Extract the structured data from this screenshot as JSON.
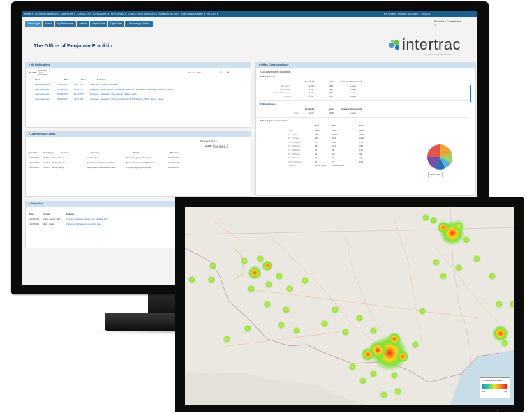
{
  "navbar": {
    "items": [
      "HOME",
      "CORRESPONDENCE",
      "CASEWORK",
      "CONTACTS",
      "SCHEDULING",
      "REPORTING",
      "CONSTITUENT SERVICES",
      "ADMINISTRATION",
      "TIME MANAGEMENT",
      "HISTORY"
    ],
    "right_items": [
      "MY TEAM",
      "CHANGE ACCOUNT",
      "LOGOUT"
    ],
    "search_placeholder": "Find Your Constituent"
  },
  "tabs": [
    "Office Pages",
    "Search",
    "My Preferences",
    "Attacks",
    "Export Data",
    "Digital Mail",
    "Knowledge Center"
  ],
  "page_title": "The Office of Benjamin Franklin",
  "logo": {
    "word": "intertrac",
    "tagline": "BY DATASPHERE DOMESTIC"
  },
  "notifications": {
    "title": "My Notifications",
    "sort_label": "Sort By",
    "sort_value": "Date",
    "pager": "Previous  1  Next",
    "columns": [
      "From",
      "Date",
      "Time",
      "Subject"
    ],
    "rows": [
      [
        "Jasmine Lowes",
        "09/26/2016",
        "03:17 PM",
        "Intertrac Print Batch Complete"
      ],
      [
        "Jasmine Lowes",
        "09/26/2016",
        "03:12 PM",
        "Assigned - Lofton Mange - Immediate action on Placentation Federalism Institute - Camp..."
      ],
      [
        "Jasmine Lowes",
        "09/26/2016",
        "03:10 PM",
        "Assigned - Research - Ping support - Mass Cases"
      ],
      [
        "Jasmine Lowes",
        "09/26/2016",
        "03:07 PM",
        "Assigned - Research - Prison contact with WTHOLESON PRAY - Ebrolt, James"
      ]
    ]
  },
  "casework": {
    "title": "Casework Due Dates",
    "pager": "Previous  1  Next",
    "sort_label": "Sort By",
    "sort_value": "Due Date",
    "columns": [
      "Due Date",
      "Tracking #",
      "Contact",
      "Agency",
      "Status",
      "Received"
    ],
    "rows": [
      [
        "10/27/2016",
        "#14616",
        "Gore, Darey",
        "Next to allow",
        "Pending Agency Response",
        "05/20/2016"
      ],
      [
        "10/13/2016",
        "#14432",
        "Smith, James",
        "Department Of Veterans Affairs",
        "Pending Collection Of Response",
        "07/29/2016"
      ],
      [
        "10/09/2017",
        "#14412",
        "Gore, Darey",
        "Department Of Veterans Affairs",
        "Pending Agency Response",
        "05/20/2016"
      ]
    ]
  },
  "reminders": {
    "title": "Reminders",
    "columns": [
      "Date",
      "Contact",
      "Subject"
    ],
    "rows": [
      [
        "10/21/2016",
        "Smith, James - MD",
        "Contact constituent about your visitation form"
      ],
      [
        "10/21/2016",
        "Mitch, Cable",
        "Follow up with agency regarding case"
      ]
    ]
  },
  "office_correspondence": {
    "title": "Office Correspondence",
    "date_range": "From 10/02/2016 To 10/12/2016",
    "mail_volumes": {
      "title": "Mail Volumes",
      "columns": [
        "Received",
        "Sent",
        "Average Turnaround"
      ],
      "rows": [
        [
          "Received",
          "1390",
          "346",
          "5 days"
        ],
        [
          "Mail Group",
          "176",
          "166",
          "7 days"
        ],
        [
          "Non Mail Group",
          "128",
          "66",
          "4 days"
        ],
        [
          "Opinion",
          "323",
          "107",
          "8 days"
        ]
      ]
    },
    "web_volumes": {
      "title": "Web Volumes",
      "columns": [
        "Received",
        "Sent",
        "Average Turnaround"
      ],
      "rows": [
        [
          "Total",
          "1100",
          "3049",
          "5 days"
        ]
      ]
    },
    "pending": {
      "title": "Pending Correspondence",
      "columns": [
        "Mail",
        "Web",
        "Total"
      ],
      "rows": [
        [
          "Total",
          "1300",
          "4902",
          "6066"
        ],
        [
          "0 - 7 Days",
          "485",
          "3,283",
          "3711"
        ],
        [
          "8 - 14 Days",
          "266",
          "843",
          "1012"
        ],
        [
          "15 - 21 Days",
          "571",
          "329",
          "752"
        ],
        [
          "22 - 30 Days",
          "191",
          "444",
          "787"
        ],
        [
          "31 - 45 Days",
          "31",
          "82",
          "113"
        ],
        [
          "46 - 60 Days",
          "12",
          "20",
          "33"
        ],
        [
          "61 - 90 Days",
          "46",
          "23",
          "47"
        ],
        [
          "Over 90 Days",
          "31",
          "72",
          "103"
        ],
        [
          "Oldest",
          "Jun 8, 2016",
          "Jan 30, 2015",
          ""
        ]
      ],
      "pie_label": "31-45 Days"
    }
  },
  "colors": {
    "nav": "#1c5f8c",
    "tab": "#2a6f9d",
    "header": "#cfe1ee",
    "link": "#2e6fb6"
  },
  "map": {
    "legend_title": "Correspondence Volume",
    "legend_low": "Low",
    "legend_high": "High"
  }
}
